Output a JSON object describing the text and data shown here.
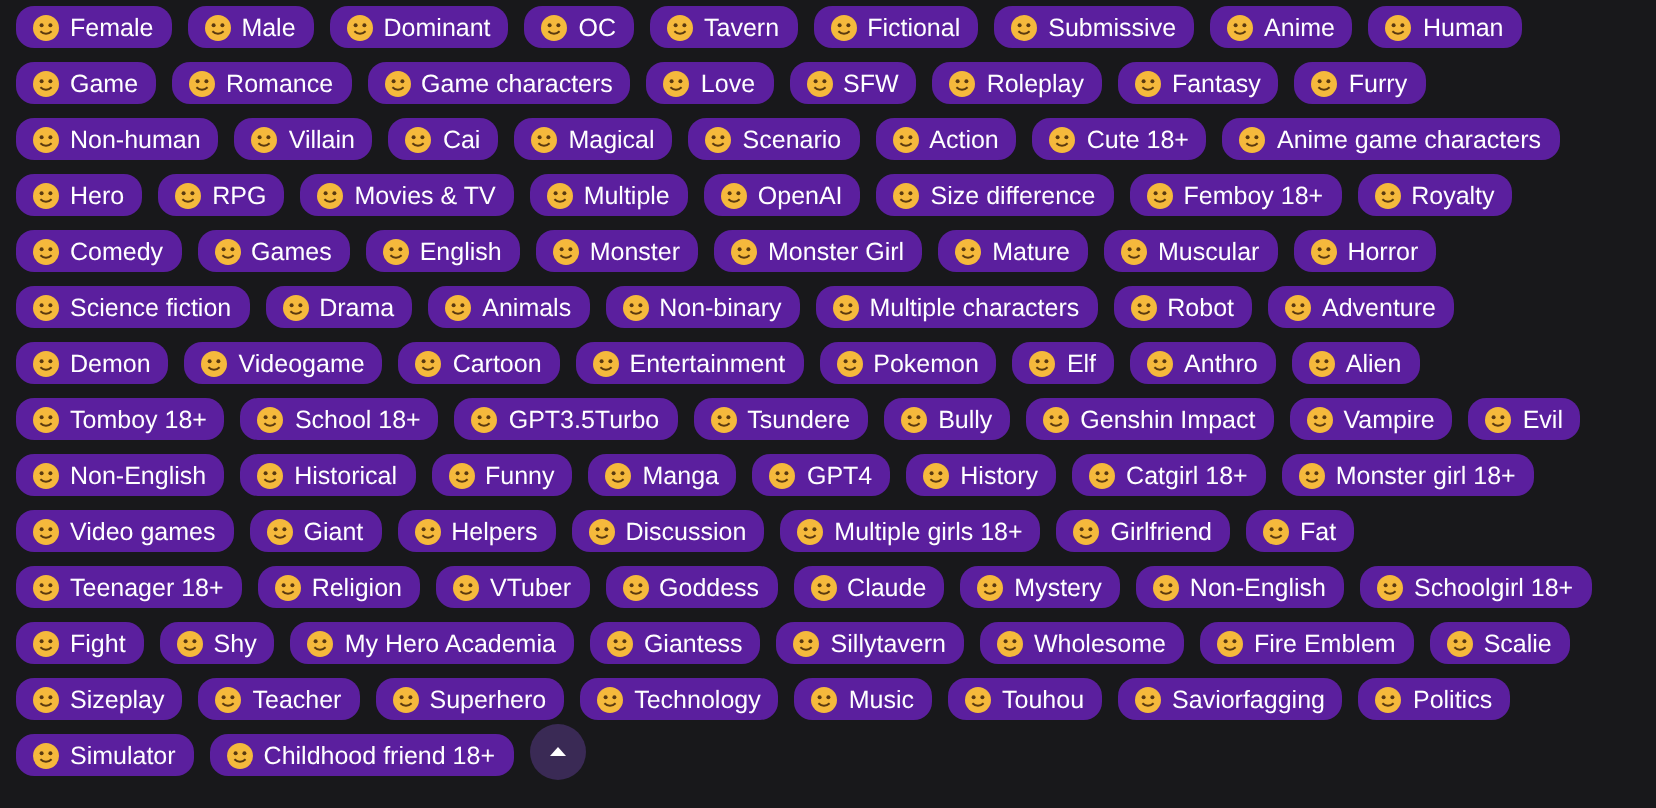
{
  "tag_rows": [
    {
      "tags": [
        "Female",
        "Male",
        "Dominant",
        "OC",
        "Tavern",
        "Fictional",
        "Submissive",
        "Anime",
        "Human"
      ]
    },
    {
      "tags": [
        "Game",
        "Romance",
        "Game characters",
        "Love",
        "SFW",
        "Roleplay",
        "Fantasy",
        "Furry"
      ]
    },
    {
      "tags": [
        "Non-human",
        "Villain",
        "Cai",
        "Magical",
        "Scenario",
        "Action",
        "Cute 18+",
        "Anime game characters"
      ]
    },
    {
      "tags": [
        "Hero",
        "RPG",
        "Movies & TV",
        "Multiple",
        "OpenAI",
        "Size difference",
        "Femboy 18+",
        "Royalty"
      ]
    },
    {
      "tags": [
        "Comedy",
        "Games",
        "English",
        "Monster",
        "Monster Girl",
        "Mature",
        "Muscular",
        "Horror"
      ]
    },
    {
      "tags": [
        "Science fiction",
        "Drama",
        "Animals",
        "Non-binary",
        "Multiple characters",
        "Robot",
        "Adventure"
      ]
    },
    {
      "tags": [
        "Demon",
        "Videogame",
        "Cartoon",
        "Entertainment",
        "Pokemon",
        "Elf",
        "Anthro",
        "Alien"
      ]
    },
    {
      "tags": [
        "Tomboy 18+",
        "School 18+",
        "GPT3.5Turbo",
        "Tsundere",
        "Bully",
        "Genshin Impact",
        "Vampire",
        "Evil"
      ]
    },
    {
      "tags": [
        "Non-English",
        "Historical",
        "Funny",
        "Manga",
        "GPT4",
        "History",
        "Catgirl 18+",
        "Monster girl 18+"
      ]
    },
    {
      "tags": [
        "Video games",
        "Giant",
        "Helpers",
        "Discussion",
        "Multiple girls 18+",
        "Girlfriend",
        "Fat"
      ]
    },
    {
      "tags": [
        "Teenager 18+",
        "Religion",
        "VTuber",
        "Goddess",
        "Claude",
        "Mystery",
        "Non-English",
        "Schoolgirl 18+"
      ]
    },
    {
      "tags": [
        "Fight",
        "Shy",
        "My Hero Academia",
        "Giantess",
        "Sillytavern",
        "Wholesome",
        "Fire Emblem",
        "Scalie"
      ]
    },
    {
      "tags": [
        "Sizeplay",
        "Teacher",
        "Superhero",
        "Technology",
        "Music",
        "Touhou",
        "Saviorfagging",
        "Politics"
      ]
    },
    {
      "tags": [
        "Simulator",
        "Childhood friend 18+"
      ]
    }
  ],
  "collapse_button": {
    "kind": "collapse"
  }
}
